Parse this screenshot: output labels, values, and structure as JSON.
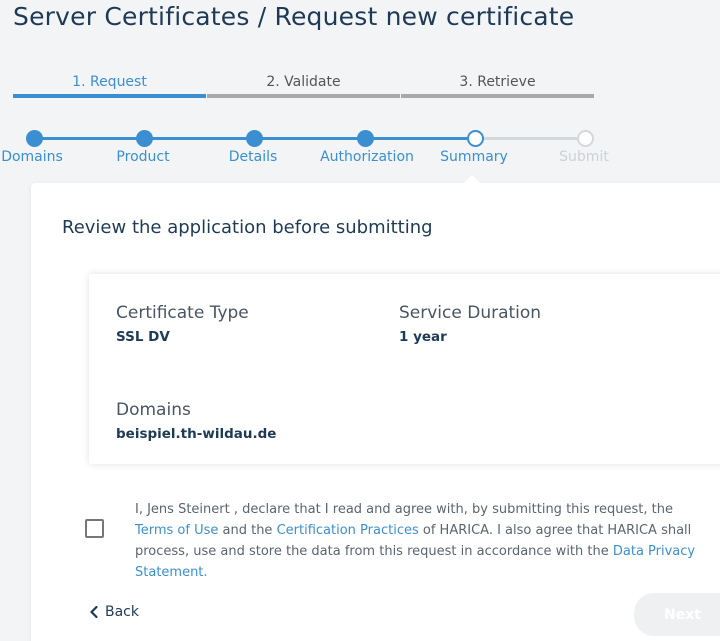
{
  "page": {
    "title": "Server Certificates / Request new certificate"
  },
  "steps": [
    {
      "label": "1. Request",
      "active": true
    },
    {
      "label": "2. Validate",
      "active": false
    },
    {
      "label": "3. Retrieve",
      "active": false
    }
  ],
  "tracker": [
    {
      "label": "Domains",
      "state": "done"
    },
    {
      "label": "Product",
      "state": "done"
    },
    {
      "label": "Details",
      "state": "done"
    },
    {
      "label": "Authorization",
      "state": "done"
    },
    {
      "label": "Summary",
      "state": "current"
    },
    {
      "label": "Submit",
      "state": "todo"
    }
  ],
  "review": {
    "heading": "Review the application before submitting",
    "certificate_type_label": "Certificate Type",
    "certificate_type_value": "SSL DV",
    "service_duration_label": "Service Duration",
    "service_duration_value": "1 year",
    "domains_label": "Domains",
    "domains_value": "beispiel.th-wildau.de"
  },
  "agreement": {
    "checked": false,
    "text_part1": "I, Jens Steinert , declare that I read and agree with, by submitting this request, the ",
    "terms_link": "Terms of Use",
    "text_part2": " and the ",
    "practices_link": "Certification Practices",
    "text_part3": " of HARICA. I also agree that HARICA shall process, use and store the data from this request in accordance with the ",
    "privacy_link": "Data Privacy Statement."
  },
  "nav": {
    "back_label": "Back",
    "next_label": "Next"
  },
  "colors": {
    "accent": "#3b8fd1",
    "inactive_bar": "#a8a8a8",
    "todo": "#d4d8dc"
  }
}
